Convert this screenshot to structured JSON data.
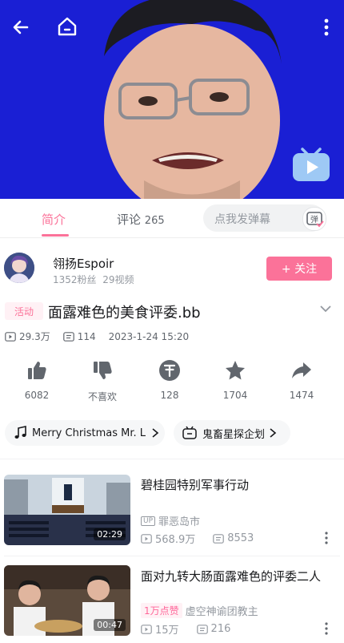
{
  "player": {
    "background_color": "#1a1fd4",
    "icons": [
      "back-arrow-icon",
      "home-icon",
      "more-vertical-icon",
      "bilibili-tv-icon"
    ]
  },
  "tabs": {
    "intro_label": "简介",
    "comments_label": "评论",
    "comments_count": "265",
    "danmu_placeholder": "点我发弹幕",
    "danmu_button_label": "弹"
  },
  "uploader": {
    "name": "翎扬Espoir",
    "fans": "1352粉丝",
    "videos": "29视频",
    "follow_label": "+ 关注"
  },
  "video": {
    "tag": "活动",
    "title": "面露难色的美食评委.bb",
    "views": "29.3万",
    "danmaku": "114",
    "date": "2023-1-24 15:20"
  },
  "actions": [
    {
      "icon": "thumbs-up-icon",
      "label": "6082"
    },
    {
      "icon": "thumbs-down-icon",
      "label": "不喜欢"
    },
    {
      "icon": "coin-icon",
      "label": "128"
    },
    {
      "icon": "star-icon",
      "label": "1704"
    },
    {
      "icon": "share-icon",
      "label": "1474"
    }
  ],
  "chips": {
    "music": "Merry Christmas Mr. L",
    "activity": "鬼畜星探企划"
  },
  "recommendations": [
    {
      "title": "碧桂园特别军事行动",
      "uploader": "罪恶岛市",
      "views": "568.9万",
      "danmaku": "8553",
      "duration": "02:29",
      "badge": ""
    },
    {
      "title": "面对九转大肠面露难色的评委二人",
      "uploader": "虚空神谕团教主",
      "views": "15万",
      "danmaku": "216",
      "duration": "00:47",
      "badge": "1万点赞"
    }
  ],
  "colors": {
    "accent": "#fb7299",
    "text_secondary": "#9499a0"
  }
}
